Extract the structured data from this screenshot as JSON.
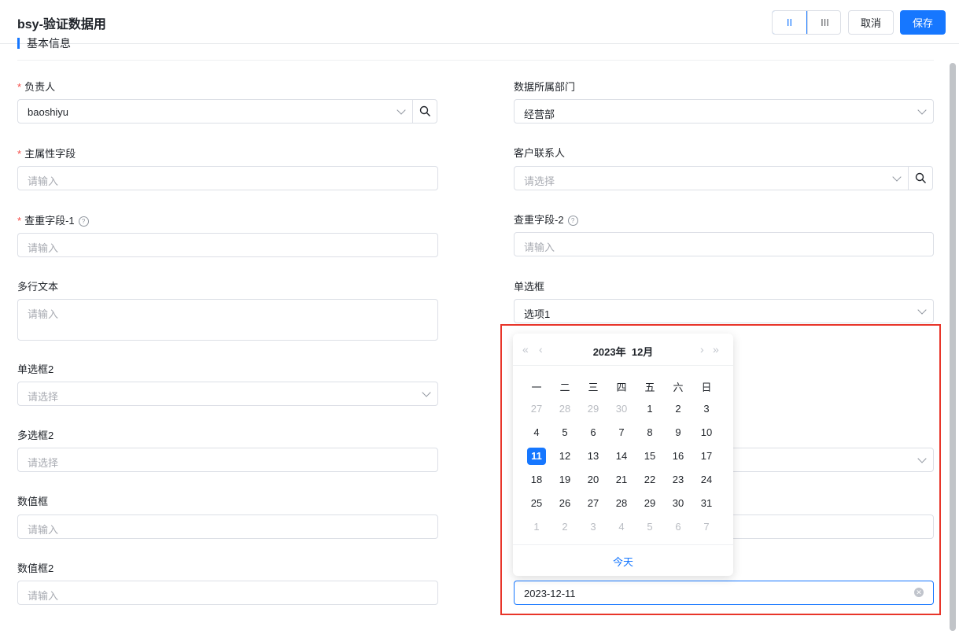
{
  "header": {
    "title": "bsy-验证数据用",
    "layout_single": "II",
    "layout_triple": "III",
    "cancel": "取消",
    "save": "保存"
  },
  "section": {
    "title": "基本信息"
  },
  "fields": {
    "owner": {
      "label": "负责人",
      "value": "baoshiyu"
    },
    "dept": {
      "label": "数据所属部门",
      "value": "经营部"
    },
    "main_attr": {
      "label": "主属性字段",
      "placeholder": "请输入"
    },
    "contact": {
      "label": "客户联系人",
      "placeholder": "请选择"
    },
    "dup1": {
      "label": "查重字段-1",
      "placeholder": "请输入"
    },
    "dup2": {
      "label": "查重字段-2",
      "placeholder": "请输入"
    },
    "multiline": {
      "label": "多行文本",
      "placeholder": "请输入"
    },
    "radio": {
      "label": "单选框",
      "value": "选项1"
    },
    "radio2": {
      "label": "单选框2",
      "placeholder": "请选择"
    },
    "multi2": {
      "label": "多选框2",
      "placeholder": "请选择"
    },
    "number": {
      "label": "数值框",
      "placeholder": "请输入"
    },
    "number2": {
      "label": "数值框2",
      "placeholder": "请输入"
    },
    "date": {
      "value": "2023-12-11"
    }
  },
  "datepicker": {
    "year_label": "2023年",
    "month_label": "12月",
    "prev_year": "«",
    "prev_month": "‹",
    "next_month": "›",
    "next_year": "»",
    "weekdays": [
      "一",
      "二",
      "三",
      "四",
      "五",
      "六",
      "日"
    ],
    "days": [
      [
        "27",
        "28",
        "29",
        "30",
        "1",
        "2",
        "3"
      ],
      [
        "4",
        "5",
        "6",
        "7",
        "8",
        "9",
        "10"
      ],
      [
        "11",
        "12",
        "13",
        "14",
        "15",
        "16",
        "17"
      ],
      [
        "18",
        "19",
        "20",
        "21",
        "22",
        "23",
        "24"
      ],
      [
        "25",
        "26",
        "27",
        "28",
        "29",
        "30",
        "31"
      ],
      [
        "1",
        "2",
        "3",
        "4",
        "5",
        "6",
        "7"
      ]
    ],
    "selected_day": "11",
    "today": "今天"
  },
  "colors": {
    "primary": "#1677ff",
    "highlight": "#e8352a",
    "required": "#f54a45"
  },
  "icons": {
    "search": "search-icon",
    "chevron": "chevron-down-icon",
    "clear": "clear-icon",
    "help": "help-icon"
  }
}
